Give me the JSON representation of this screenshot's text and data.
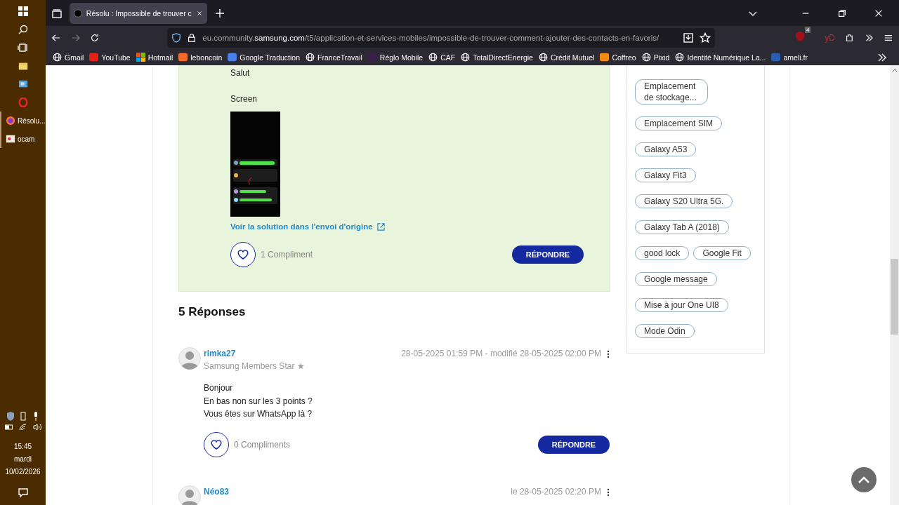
{
  "taskbar": {
    "apps": [
      {
        "label": "Résolu...",
        "kind": "firefox"
      },
      {
        "label": "ocam",
        "kind": "recorder"
      }
    ],
    "clock": {
      "time": "15:45",
      "day": "mardi",
      "date": "10/02/2026"
    }
  },
  "browser": {
    "tabs": [
      {
        "title": "Résolu : Impossible de trouver c",
        "selected": true
      }
    ],
    "url": {
      "prefix": "eu.community.",
      "domain": "samsung.com",
      "path": "/t5/application-et-services-mobiles/impossible-de-trouver-comment-ajouter-des-contacts-en-favoris/"
    },
    "extension_badge": "4",
    "extension_label": "yD",
    "bookmarks": [
      {
        "label": "Gmail",
        "kind": "globe"
      },
      {
        "label": "YouTube",
        "kind": "logo",
        "color": "#e62117"
      },
      {
        "label": "Hotmail",
        "kind": "tiles"
      },
      {
        "label": "leboncoin",
        "kind": "logo",
        "color": "#f56b2a"
      },
      {
        "label": "Google Traduction",
        "kind": "logo",
        "color": "#4a7ee8"
      },
      {
        "label": "FranceTravail",
        "kind": "globe"
      },
      {
        "label": "Réglo Mobile",
        "kind": "logo",
        "color": "#3a1f4a"
      },
      {
        "label": "CAF",
        "kind": "globe"
      },
      {
        "label": "TotalDirectEnergie",
        "kind": "globe"
      },
      {
        "label": "Crédit Mutuel",
        "kind": "globe"
      },
      {
        "label": "Coffreo",
        "kind": "logo",
        "color": "#f28c12"
      },
      {
        "label": "Pixid",
        "kind": "globe"
      },
      {
        "label": "Identité Numérique La...",
        "kind": "globe"
      },
      {
        "label": "ameli.fr",
        "kind": "logo",
        "color": "#2a5db0"
      }
    ]
  },
  "solution_post": {
    "accepted": true,
    "lines": [
      "Salut",
      "Screen"
    ],
    "image": {
      "kind": "picture"
    },
    "solution_link": "Voir la solution dans l'envoi d'origine",
    "compliments": "1 Compliment",
    "reply_button": "RÉPONDRE"
  },
  "replies_heading": "5 Réponses",
  "replies": [
    {
      "author": "rimka27",
      "rank": "Samsung Members Star ★",
      "date": "28-05-2025 01:59 PM - modifié 28-05-2025 02:00 PM",
      "lines": [
        "Bonjour",
        "En bas non sur les 3 points ?",
        "Vous êtes sur WhatsApp là ?"
      ],
      "compliments": "0 Compliments",
      "reply_button": "RÉPONDRE"
    },
    {
      "author": "Néo83",
      "date": "le 28-05-2025 02:20 PM"
    }
  ],
  "sidebar": {
    "tags": [
      "Emplacement de stockage...",
      "Emplacement SIM",
      "Galaxy A53",
      "Galaxy Fit3",
      "Galaxy S20 Ultra 5G.",
      "Galaxy Tab A (2018)",
      "good lock",
      "Google Fit",
      "Google message",
      "Mise à jour One UI8",
      "Mode Odin"
    ]
  }
}
